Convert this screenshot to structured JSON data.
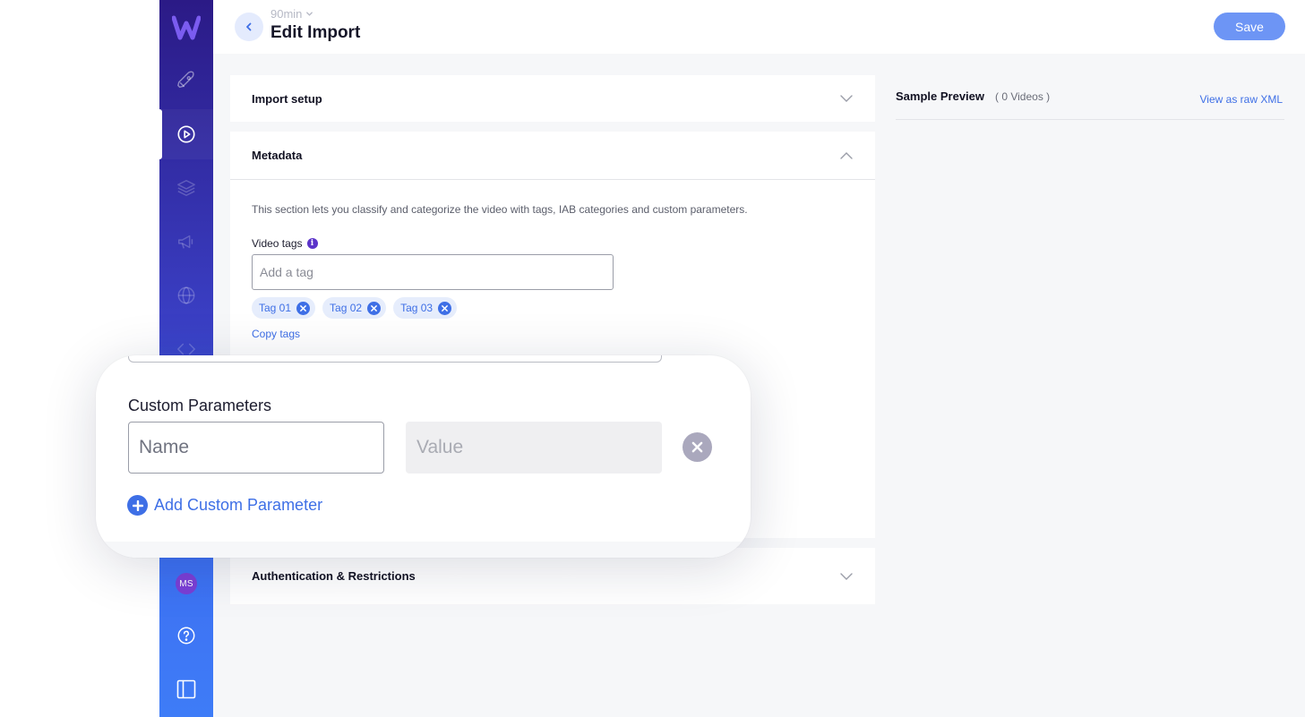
{
  "header": {
    "breadcrumb": "90min",
    "title": "Edit Import",
    "save_label": "Save"
  },
  "sidebar": {
    "avatar_initials": "MS",
    "items": [
      {
        "icon": "rocket-icon"
      },
      {
        "icon": "play-circle-icon",
        "active": true
      },
      {
        "icon": "layers-icon"
      },
      {
        "icon": "megaphone-icon"
      },
      {
        "icon": "globe-icon"
      },
      {
        "icon": "code-icon"
      },
      {
        "icon": "help-circle-icon"
      },
      {
        "icon": "panel-icon"
      }
    ]
  },
  "sections": {
    "import_setup": {
      "title": "Import setup"
    },
    "metadata": {
      "title": "Metadata",
      "description": "This section lets you classify and categorize the video with tags, IAB categories and custom parameters.",
      "video_tags_label": "Video tags",
      "tag_placeholder": "Add a tag",
      "tags": [
        "Tag 01",
        "Tag 02",
        "Tag 03"
      ],
      "copy_tags_label": "Copy tags"
    },
    "auth": {
      "title": "Authentication & Restrictions"
    }
  },
  "preview": {
    "title": "Sample Preview",
    "count": "( 0 Videos )",
    "raw_xml_link": "View as raw XML"
  },
  "custom_params": {
    "label": "Custom Parameters",
    "name_placeholder": "Name",
    "value_placeholder": "Value",
    "add_label": "Add Custom Parameter"
  },
  "colors": {
    "accent": "#3e6fe6",
    "save_button": "#6d95f5",
    "sidebar_top": "#2b1a86",
    "sidebar_bottom": "#3e7cf7"
  }
}
